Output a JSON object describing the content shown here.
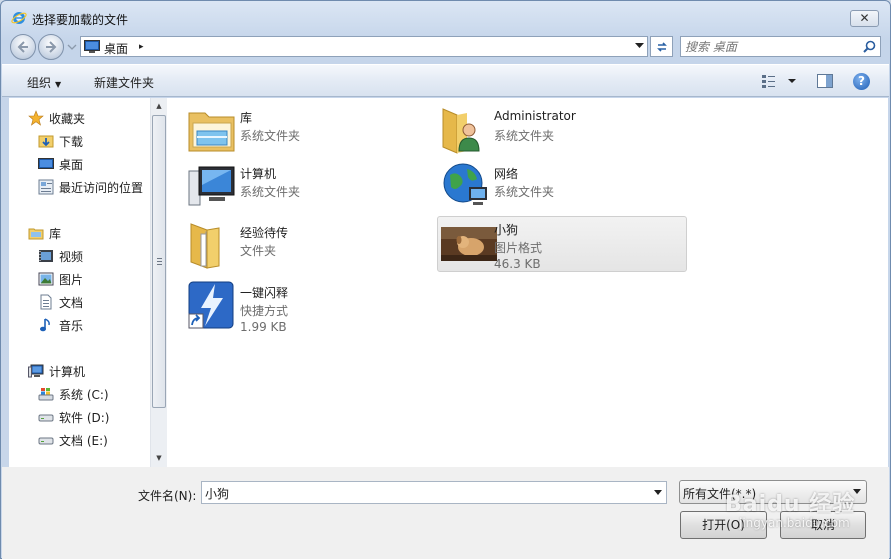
{
  "window": {
    "title": "选择要加载的文件",
    "close_label": "✕"
  },
  "address": {
    "location": "桌面",
    "separator": "▸"
  },
  "search": {
    "placeholder": "搜索 桌面"
  },
  "toolbar": {
    "organize_label": "组织",
    "new_folder_label": "新建文件夹",
    "help_label": "?"
  },
  "nav": {
    "favorites": {
      "label": "收藏夹",
      "items": [
        {
          "label": "下载",
          "icon": "download-folder-icon"
        },
        {
          "label": "桌面",
          "icon": "desktop-icon"
        },
        {
          "label": "最近访问的位置",
          "icon": "recent-places-icon"
        }
      ]
    },
    "libraries": {
      "label": "库",
      "items": [
        {
          "label": "视频",
          "icon": "video-icon"
        },
        {
          "label": "图片",
          "icon": "picture-icon"
        },
        {
          "label": "文档",
          "icon": "document-icon"
        },
        {
          "label": "音乐",
          "icon": "music-icon"
        }
      ]
    },
    "computer": {
      "label": "计算机",
      "items": [
        {
          "label": "系统 (C:)",
          "icon": "system-drive-icon"
        },
        {
          "label": "软件 (D:)",
          "icon": "drive-icon"
        },
        {
          "label": "文档 (E:)",
          "icon": "drive-icon"
        }
      ]
    }
  },
  "files": [
    {
      "name": "库",
      "type": "系统文件夹",
      "icon": "library-icon"
    },
    {
      "name": "Administrator",
      "type": "系统文件夹",
      "icon": "user-folder-icon"
    },
    {
      "name": "计算机",
      "type": "系统文件夹",
      "icon": "computer-icon"
    },
    {
      "name": "网络",
      "type": "系统文件夹",
      "icon": "network-icon"
    },
    {
      "name": "经验待传",
      "type": "文件夹",
      "icon": "folder-icon"
    },
    {
      "name": "小狗",
      "type": "图片格式",
      "size": "46.3 KB",
      "icon": "image-thumbnail-icon",
      "selected": true
    },
    {
      "name": "一键闪释",
      "type": "快捷方式",
      "size": "1.99 KB",
      "icon": "shortcut-icon"
    }
  ],
  "bottom": {
    "filename_label": "文件名(N):",
    "filename_value": "小狗",
    "filetype_value": "所有文件(*.*)",
    "open_label": "打开(O)",
    "cancel_label": "取消"
  },
  "watermark": {
    "brand": "Baidu 经验",
    "url": "jingyan.baidu.com"
  },
  "colors": {
    "accent": "#2a62a5",
    "window_frame": "#c9d7ea",
    "selection": "#e5e5e5"
  }
}
